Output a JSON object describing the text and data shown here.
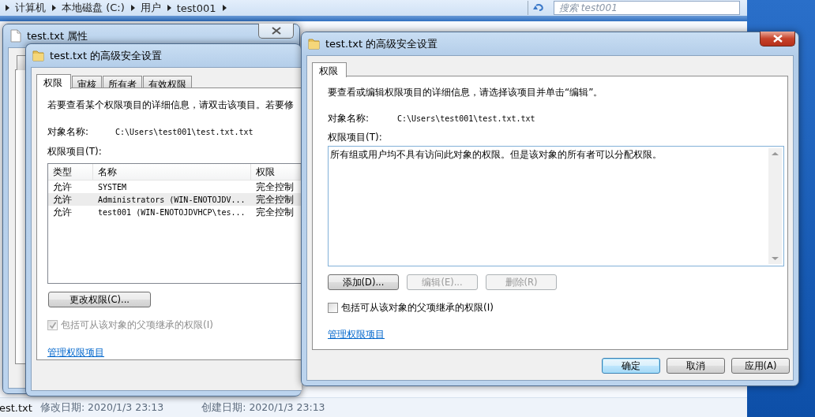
{
  "explorer": {
    "breadcrumb": [
      "计算机",
      "本地磁盘 (C:)",
      "用户",
      "test001"
    ],
    "search": {
      "placeholder": "搜索 test001"
    },
    "status": {
      "file": "est.txt",
      "modified": "修改日期: 2020/1/3 23:13",
      "created": "创建日期: 2020/1/3 23:13"
    }
  },
  "properties_window": {
    "title": "test.txt 属性"
  },
  "advanced_window_back": {
    "title": "test.txt 的高级安全设置",
    "tabs": [
      {
        "label": "权限",
        "selected": true
      },
      {
        "label": "审核",
        "selected": false
      },
      {
        "label": "所有者",
        "selected": false
      },
      {
        "label": "有效权限",
        "selected": false
      }
    ],
    "intro": "若要查看某个权限项目的详细信息，请双击该项目。若要修",
    "object_label": "对象名称:",
    "object_path": "C:\\Users\\test001\\test.txt.txt",
    "entries_label": "权限项目(T):",
    "table": {
      "columns": [
        "类型",
        "名称",
        "权限"
      ],
      "rows": [
        {
          "cells": [
            "允许",
            "SYSTEM",
            "完全控制"
          ],
          "selected": false
        },
        {
          "cells": [
            "允许",
            "Administrators (WIN-ENOTOJDV...",
            "完全控制"
          ],
          "selected": true
        },
        {
          "cells": [
            "允许",
            "test001 (WIN-ENOTOJDVHCP\\tes...",
            "完全控制"
          ],
          "selected": false
        }
      ]
    },
    "change_button": "更改权限(C)...",
    "inherit": {
      "label": "包括可从该对象的父项继承的权限(I)",
      "checked": true,
      "disabled": true
    },
    "link": "管理权限项目"
  },
  "advanced_window_front": {
    "title": "test.txt 的高级安全设置",
    "tabs": [
      {
        "label": "权限",
        "selected": true
      }
    ],
    "intro": "要查看或编辑权限项目的详细信息，请选择该项目并单击“编辑”。",
    "object_label": "对象名称:",
    "object_path": "C:\\Users\\test001\\test.txt.txt",
    "entries_label": "权限项目(T):",
    "entries_message": "所有组或用户均不具有访问此对象的权限。但是该对象的所有者可以分配权限。",
    "buttons": [
      {
        "label": "添加(D)...",
        "disabled": false
      },
      {
        "label": "编辑(E)...",
        "disabled": true
      },
      {
        "label": "删除(R)",
        "disabled": true
      }
    ],
    "inherit": {
      "label": "包括可从该对象的父项继承的权限(I)",
      "checked": false,
      "disabled": false
    },
    "link": "管理权限项目",
    "footer_buttons": [
      {
        "label": "确定",
        "default": true
      },
      {
        "label": "取消",
        "default": false
      },
      {
        "label": "应用(A)",
        "default": false
      }
    ]
  }
}
